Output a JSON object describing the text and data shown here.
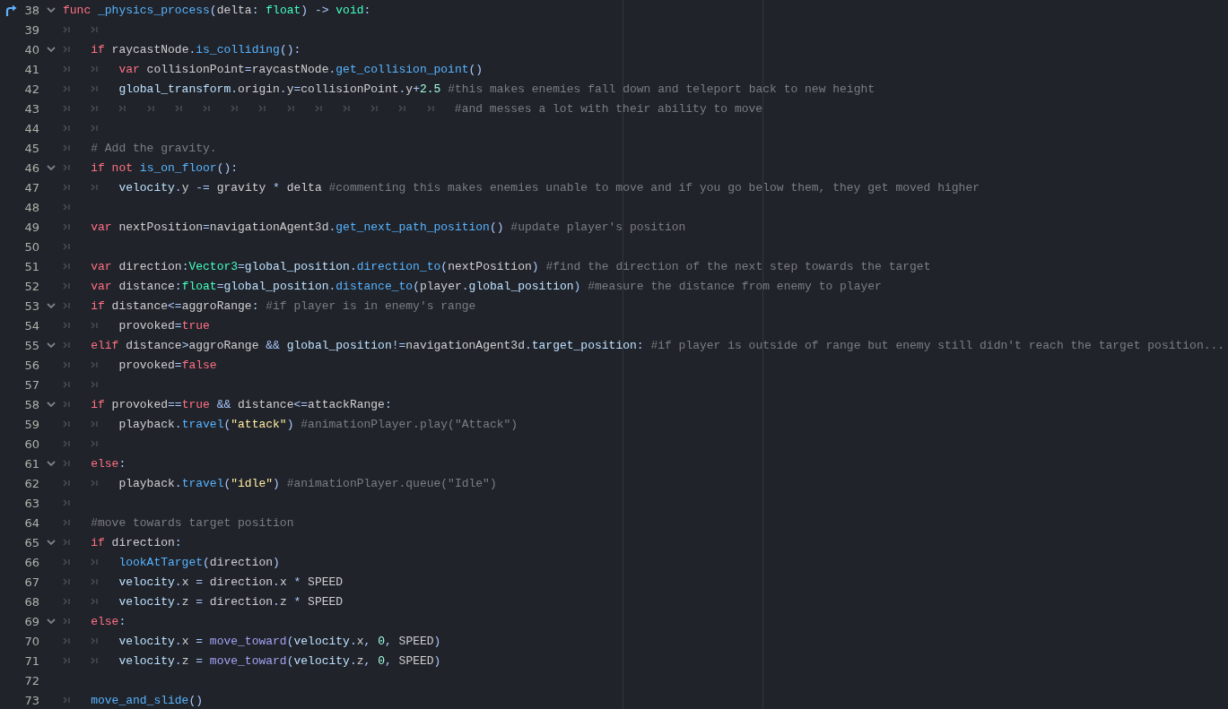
{
  "editor": {
    "lines": [
      {
        "number": "38",
        "foldable": true,
        "override": true,
        "tokens": [
          {
            "kind": "kw",
            "text": "func "
          },
          {
            "kind": "fn",
            "text": "_physics_process"
          },
          {
            "kind": "sym",
            "text": "("
          },
          {
            "kind": "plain",
            "text": "delta"
          },
          {
            "kind": "sym",
            "text": ": "
          },
          {
            "kind": "type",
            "text": "float"
          },
          {
            "kind": "sym",
            "text": ") -> "
          },
          {
            "kind": "type",
            "text": "void"
          },
          {
            "kind": "sym",
            "text": ":"
          }
        ]
      },
      {
        "number": "39",
        "foldable": false,
        "override": false,
        "tokens": [
          {
            "kind": "tab"
          },
          {
            "kind": "tab"
          }
        ]
      },
      {
        "number": "40",
        "foldable": true,
        "override": false,
        "tokens": [
          {
            "kind": "tab"
          },
          {
            "kind": "kw",
            "text": "if"
          },
          {
            "kind": "plain",
            "text": " raycastNode"
          },
          {
            "kind": "sym",
            "text": "."
          },
          {
            "kind": "fn",
            "text": "is_colliding"
          },
          {
            "kind": "sym",
            "text": "():"
          }
        ]
      },
      {
        "number": "41",
        "foldable": false,
        "override": false,
        "tokens": [
          {
            "kind": "tab"
          },
          {
            "kind": "tab"
          },
          {
            "kind": "kw",
            "text": "var"
          },
          {
            "kind": "plain",
            "text": " collisionPoint"
          },
          {
            "kind": "sym",
            "text": "="
          },
          {
            "kind": "plain",
            "text": "raycastNode"
          },
          {
            "kind": "sym",
            "text": "."
          },
          {
            "kind": "fn",
            "text": "get_collision_point"
          },
          {
            "kind": "sym",
            "text": "()"
          }
        ]
      },
      {
        "number": "42",
        "foldable": false,
        "override": false,
        "tokens": [
          {
            "kind": "tab"
          },
          {
            "kind": "tab"
          },
          {
            "kind": "member",
            "text": "global_transform"
          },
          {
            "kind": "sym",
            "text": "."
          },
          {
            "kind": "plain",
            "text": "origin"
          },
          {
            "kind": "sym",
            "text": "."
          },
          {
            "kind": "plain",
            "text": "y"
          },
          {
            "kind": "sym",
            "text": "="
          },
          {
            "kind": "plain",
            "text": "collisionPoint"
          },
          {
            "kind": "sym",
            "text": "."
          },
          {
            "kind": "plain",
            "text": "y"
          },
          {
            "kind": "sym",
            "text": "+"
          },
          {
            "kind": "num",
            "text": "2.5 "
          },
          {
            "kind": "cmt",
            "text": "#this makes enemies fall down and teleport back to new height"
          }
        ]
      },
      {
        "number": "43",
        "foldable": false,
        "override": false,
        "tokens": [
          {
            "kind": "tab"
          },
          {
            "kind": "tab"
          },
          {
            "kind": "tab"
          },
          {
            "kind": "tab"
          },
          {
            "kind": "tab"
          },
          {
            "kind": "tab"
          },
          {
            "kind": "tab"
          },
          {
            "kind": "tab"
          },
          {
            "kind": "tab"
          },
          {
            "kind": "tab"
          },
          {
            "kind": "tab"
          },
          {
            "kind": "tab"
          },
          {
            "kind": "tab"
          },
          {
            "kind": "tab"
          },
          {
            "kind": "cmt",
            "text": "#and messes a lot with their ability to move"
          }
        ]
      },
      {
        "number": "44",
        "foldable": false,
        "override": false,
        "tokens": [
          {
            "kind": "tab"
          },
          {
            "kind": "tab"
          }
        ]
      },
      {
        "number": "45",
        "foldable": false,
        "override": false,
        "tokens": [
          {
            "kind": "tab"
          },
          {
            "kind": "cmt",
            "text": "# Add the gravity."
          }
        ]
      },
      {
        "number": "46",
        "foldable": true,
        "override": false,
        "tokens": [
          {
            "kind": "tab"
          },
          {
            "kind": "kw",
            "text": "if "
          },
          {
            "kind": "kw",
            "text": "not "
          },
          {
            "kind": "fn",
            "text": "is_on_floor"
          },
          {
            "kind": "sym",
            "text": "():"
          }
        ]
      },
      {
        "number": "47",
        "foldable": false,
        "override": false,
        "tokens": [
          {
            "kind": "tab"
          },
          {
            "kind": "tab"
          },
          {
            "kind": "member",
            "text": "velocity"
          },
          {
            "kind": "sym",
            "text": "."
          },
          {
            "kind": "plain",
            "text": "y"
          },
          {
            "kind": "sym",
            "text": " -= "
          },
          {
            "kind": "plain",
            "text": "gravity"
          },
          {
            "kind": "sym",
            "text": " * "
          },
          {
            "kind": "plain",
            "text": "delta "
          },
          {
            "kind": "cmt",
            "text": "#commenting this makes enemies unable to move and if you go below them, they get moved higher"
          }
        ]
      },
      {
        "number": "48",
        "foldable": false,
        "override": false,
        "tokens": [
          {
            "kind": "tab"
          }
        ]
      },
      {
        "number": "49",
        "foldable": false,
        "override": false,
        "tokens": [
          {
            "kind": "tab"
          },
          {
            "kind": "kw",
            "text": "var"
          },
          {
            "kind": "plain",
            "text": " nextPosition"
          },
          {
            "kind": "sym",
            "text": "="
          },
          {
            "kind": "plain",
            "text": "navigationAgent3d"
          },
          {
            "kind": "sym",
            "text": "."
          },
          {
            "kind": "fn",
            "text": "get_next_path_position"
          },
          {
            "kind": "sym",
            "text": "() "
          },
          {
            "kind": "cmt",
            "text": "#update player's position"
          }
        ]
      },
      {
        "number": "50",
        "foldable": false,
        "override": false,
        "tokens": [
          {
            "kind": "tab"
          }
        ]
      },
      {
        "number": "51",
        "foldable": false,
        "override": false,
        "tokens": [
          {
            "kind": "tab"
          },
          {
            "kind": "kw",
            "text": "var"
          },
          {
            "kind": "plain",
            "text": " direction"
          },
          {
            "kind": "sym",
            "text": ":"
          },
          {
            "kind": "type",
            "text": "Vector3"
          },
          {
            "kind": "sym",
            "text": "="
          },
          {
            "kind": "member",
            "text": "global_position"
          },
          {
            "kind": "sym",
            "text": "."
          },
          {
            "kind": "fn",
            "text": "direction_to"
          },
          {
            "kind": "sym",
            "text": "("
          },
          {
            "kind": "plain",
            "text": "nextPosition"
          },
          {
            "kind": "sym",
            "text": ") "
          },
          {
            "kind": "cmt",
            "text": "#find the direction of the next step towards the target"
          }
        ]
      },
      {
        "number": "52",
        "foldable": false,
        "override": false,
        "tokens": [
          {
            "kind": "tab"
          },
          {
            "kind": "kw",
            "text": "var"
          },
          {
            "kind": "plain",
            "text": " distance"
          },
          {
            "kind": "sym",
            "text": ":"
          },
          {
            "kind": "type",
            "text": "float"
          },
          {
            "kind": "sym",
            "text": "="
          },
          {
            "kind": "member",
            "text": "global_position"
          },
          {
            "kind": "sym",
            "text": "."
          },
          {
            "kind": "fn",
            "text": "distance_to"
          },
          {
            "kind": "sym",
            "text": "("
          },
          {
            "kind": "plain",
            "text": "player"
          },
          {
            "kind": "sym",
            "text": "."
          },
          {
            "kind": "member",
            "text": "global_position"
          },
          {
            "kind": "sym",
            "text": ") "
          },
          {
            "kind": "cmt",
            "text": "#measure the distance from enemy to player"
          }
        ]
      },
      {
        "number": "53",
        "foldable": true,
        "override": false,
        "tokens": [
          {
            "kind": "tab"
          },
          {
            "kind": "kw",
            "text": "if"
          },
          {
            "kind": "plain",
            "text": " distance"
          },
          {
            "kind": "sym",
            "text": "<="
          },
          {
            "kind": "plain",
            "text": "aggroRange"
          },
          {
            "kind": "sym",
            "text": ": "
          },
          {
            "kind": "cmt",
            "text": "#if player is in enemy's range"
          }
        ]
      },
      {
        "number": "54",
        "foldable": false,
        "override": false,
        "tokens": [
          {
            "kind": "tab"
          },
          {
            "kind": "tab"
          },
          {
            "kind": "plain",
            "text": "provoked"
          },
          {
            "kind": "sym",
            "text": "="
          },
          {
            "kind": "kw",
            "text": "true"
          }
        ]
      },
      {
        "number": "55",
        "foldable": true,
        "override": false,
        "tokens": [
          {
            "kind": "tab"
          },
          {
            "kind": "kw",
            "text": "elif"
          },
          {
            "kind": "plain",
            "text": " distance"
          },
          {
            "kind": "sym",
            "text": ">"
          },
          {
            "kind": "plain",
            "text": "aggroRange "
          },
          {
            "kind": "sym",
            "text": "&& "
          },
          {
            "kind": "member",
            "text": "global_position"
          },
          {
            "kind": "sym",
            "text": "!="
          },
          {
            "kind": "plain",
            "text": "navigationAgent3d"
          },
          {
            "kind": "sym",
            "text": "."
          },
          {
            "kind": "member",
            "text": "target_position"
          },
          {
            "kind": "sym",
            "text": ": "
          },
          {
            "kind": "cmt",
            "text": "#if player is outside of range but enemy still didn't reach the target position..."
          }
        ]
      },
      {
        "number": "56",
        "foldable": false,
        "override": false,
        "tokens": [
          {
            "kind": "tab"
          },
          {
            "kind": "tab"
          },
          {
            "kind": "plain",
            "text": "provoked"
          },
          {
            "kind": "sym",
            "text": "="
          },
          {
            "kind": "kw",
            "text": "false"
          }
        ]
      },
      {
        "number": "57",
        "foldable": false,
        "override": false,
        "tokens": [
          {
            "kind": "tab"
          },
          {
            "kind": "tab"
          }
        ]
      },
      {
        "number": "58",
        "foldable": true,
        "override": false,
        "tokens": [
          {
            "kind": "tab"
          },
          {
            "kind": "kw",
            "text": "if"
          },
          {
            "kind": "plain",
            "text": " provoked"
          },
          {
            "kind": "sym",
            "text": "=="
          },
          {
            "kind": "kw",
            "text": "true "
          },
          {
            "kind": "sym",
            "text": "&&"
          },
          {
            "kind": "plain",
            "text": " distance"
          },
          {
            "kind": "sym",
            "text": "<="
          },
          {
            "kind": "plain",
            "text": "attackRange"
          },
          {
            "kind": "sym",
            "text": ":"
          }
        ]
      },
      {
        "number": "59",
        "foldable": false,
        "override": false,
        "tokens": [
          {
            "kind": "tab"
          },
          {
            "kind": "tab"
          },
          {
            "kind": "plain",
            "text": "playback"
          },
          {
            "kind": "sym",
            "text": "."
          },
          {
            "kind": "fn",
            "text": "travel"
          },
          {
            "kind": "sym",
            "text": "("
          },
          {
            "kind": "str",
            "text": "\"attack\""
          },
          {
            "kind": "sym",
            "text": ") "
          },
          {
            "kind": "cmt",
            "text": "#animationPlayer.play(\"Attack\")"
          }
        ]
      },
      {
        "number": "60",
        "foldable": false,
        "override": false,
        "tokens": [
          {
            "kind": "tab"
          },
          {
            "kind": "tab"
          }
        ]
      },
      {
        "number": "61",
        "foldable": true,
        "override": false,
        "tokens": [
          {
            "kind": "tab"
          },
          {
            "kind": "kw",
            "text": "else"
          },
          {
            "kind": "sym",
            "text": ":"
          }
        ]
      },
      {
        "number": "62",
        "foldable": false,
        "override": false,
        "tokens": [
          {
            "kind": "tab"
          },
          {
            "kind": "tab"
          },
          {
            "kind": "plain",
            "text": "playback"
          },
          {
            "kind": "sym",
            "text": "."
          },
          {
            "kind": "fn",
            "text": "travel"
          },
          {
            "kind": "sym",
            "text": "("
          },
          {
            "kind": "str",
            "text": "\"idle\""
          },
          {
            "kind": "sym",
            "text": ") "
          },
          {
            "kind": "cmt",
            "text": "#animationPlayer.queue(\"Idle\")"
          }
        ]
      },
      {
        "number": "63",
        "foldable": false,
        "override": false,
        "tokens": [
          {
            "kind": "tab"
          }
        ]
      },
      {
        "number": "64",
        "foldable": false,
        "override": false,
        "tokens": [
          {
            "kind": "tab"
          },
          {
            "kind": "cmt",
            "text": "#move towards target position"
          }
        ]
      },
      {
        "number": "65",
        "foldable": true,
        "override": false,
        "tokens": [
          {
            "kind": "tab"
          },
          {
            "kind": "kw",
            "text": "if"
          },
          {
            "kind": "plain",
            "text": " direction"
          },
          {
            "kind": "sym",
            "text": ":"
          }
        ]
      },
      {
        "number": "66",
        "foldable": false,
        "override": false,
        "tokens": [
          {
            "kind": "tab"
          },
          {
            "kind": "tab"
          },
          {
            "kind": "fn",
            "text": "lookAtTarget"
          },
          {
            "kind": "sym",
            "text": "("
          },
          {
            "kind": "plain",
            "text": "direction"
          },
          {
            "kind": "sym",
            "text": ")"
          }
        ]
      },
      {
        "number": "67",
        "foldable": false,
        "override": false,
        "tokens": [
          {
            "kind": "tab"
          },
          {
            "kind": "tab"
          },
          {
            "kind": "member",
            "text": "velocity"
          },
          {
            "kind": "sym",
            "text": "."
          },
          {
            "kind": "plain",
            "text": "x"
          },
          {
            "kind": "sym",
            "text": " = "
          },
          {
            "kind": "plain",
            "text": "direction"
          },
          {
            "kind": "sym",
            "text": "."
          },
          {
            "kind": "plain",
            "text": "x"
          },
          {
            "kind": "sym",
            "text": " * "
          },
          {
            "kind": "plain",
            "text": "SPEED"
          }
        ]
      },
      {
        "number": "68",
        "foldable": false,
        "override": false,
        "tokens": [
          {
            "kind": "tab"
          },
          {
            "kind": "tab"
          },
          {
            "kind": "member",
            "text": "velocity"
          },
          {
            "kind": "sym",
            "text": "."
          },
          {
            "kind": "plain",
            "text": "z"
          },
          {
            "kind": "sym",
            "text": " = "
          },
          {
            "kind": "plain",
            "text": "direction"
          },
          {
            "kind": "sym",
            "text": "."
          },
          {
            "kind": "plain",
            "text": "z"
          },
          {
            "kind": "sym",
            "text": " * "
          },
          {
            "kind": "plain",
            "text": "SPEED"
          }
        ]
      },
      {
        "number": "69",
        "foldable": true,
        "override": false,
        "tokens": [
          {
            "kind": "tab"
          },
          {
            "kind": "kw",
            "text": "else"
          },
          {
            "kind": "sym",
            "text": ":"
          }
        ]
      },
      {
        "number": "70",
        "foldable": false,
        "override": false,
        "tokens": [
          {
            "kind": "tab"
          },
          {
            "kind": "tab"
          },
          {
            "kind": "member",
            "text": "velocity"
          },
          {
            "kind": "sym",
            "text": "."
          },
          {
            "kind": "plain",
            "text": "x"
          },
          {
            "kind": "sym",
            "text": " = "
          },
          {
            "kind": "builtin",
            "text": "move_toward"
          },
          {
            "kind": "sym",
            "text": "("
          },
          {
            "kind": "member",
            "text": "velocity"
          },
          {
            "kind": "sym",
            "text": "."
          },
          {
            "kind": "plain",
            "text": "x"
          },
          {
            "kind": "sym",
            "text": ", "
          },
          {
            "kind": "num",
            "text": "0"
          },
          {
            "kind": "sym",
            "text": ", "
          },
          {
            "kind": "plain",
            "text": "SPEED"
          },
          {
            "kind": "sym",
            "text": ")"
          }
        ]
      },
      {
        "number": "71",
        "foldable": false,
        "override": false,
        "tokens": [
          {
            "kind": "tab"
          },
          {
            "kind": "tab"
          },
          {
            "kind": "member",
            "text": "velocity"
          },
          {
            "kind": "sym",
            "text": "."
          },
          {
            "kind": "plain",
            "text": "z"
          },
          {
            "kind": "sym",
            "text": " = "
          },
          {
            "kind": "builtin",
            "text": "move_toward"
          },
          {
            "kind": "sym",
            "text": "("
          },
          {
            "kind": "member",
            "text": "velocity"
          },
          {
            "kind": "sym",
            "text": "."
          },
          {
            "kind": "plain",
            "text": "z"
          },
          {
            "kind": "sym",
            "text": ", "
          },
          {
            "kind": "num",
            "text": "0"
          },
          {
            "kind": "sym",
            "text": ", "
          },
          {
            "kind": "plain",
            "text": "SPEED"
          },
          {
            "kind": "sym",
            "text": ")"
          }
        ]
      },
      {
        "number": "72",
        "foldable": false,
        "override": false
      },
      {
        "number": "73",
        "foldable": false,
        "override": false,
        "tokens": [
          {
            "kind": "tab"
          },
          {
            "kind": "fn",
            "text": "move_and_slide"
          },
          {
            "kind": "sym",
            "text": "()"
          }
        ]
      }
    ]
  }
}
